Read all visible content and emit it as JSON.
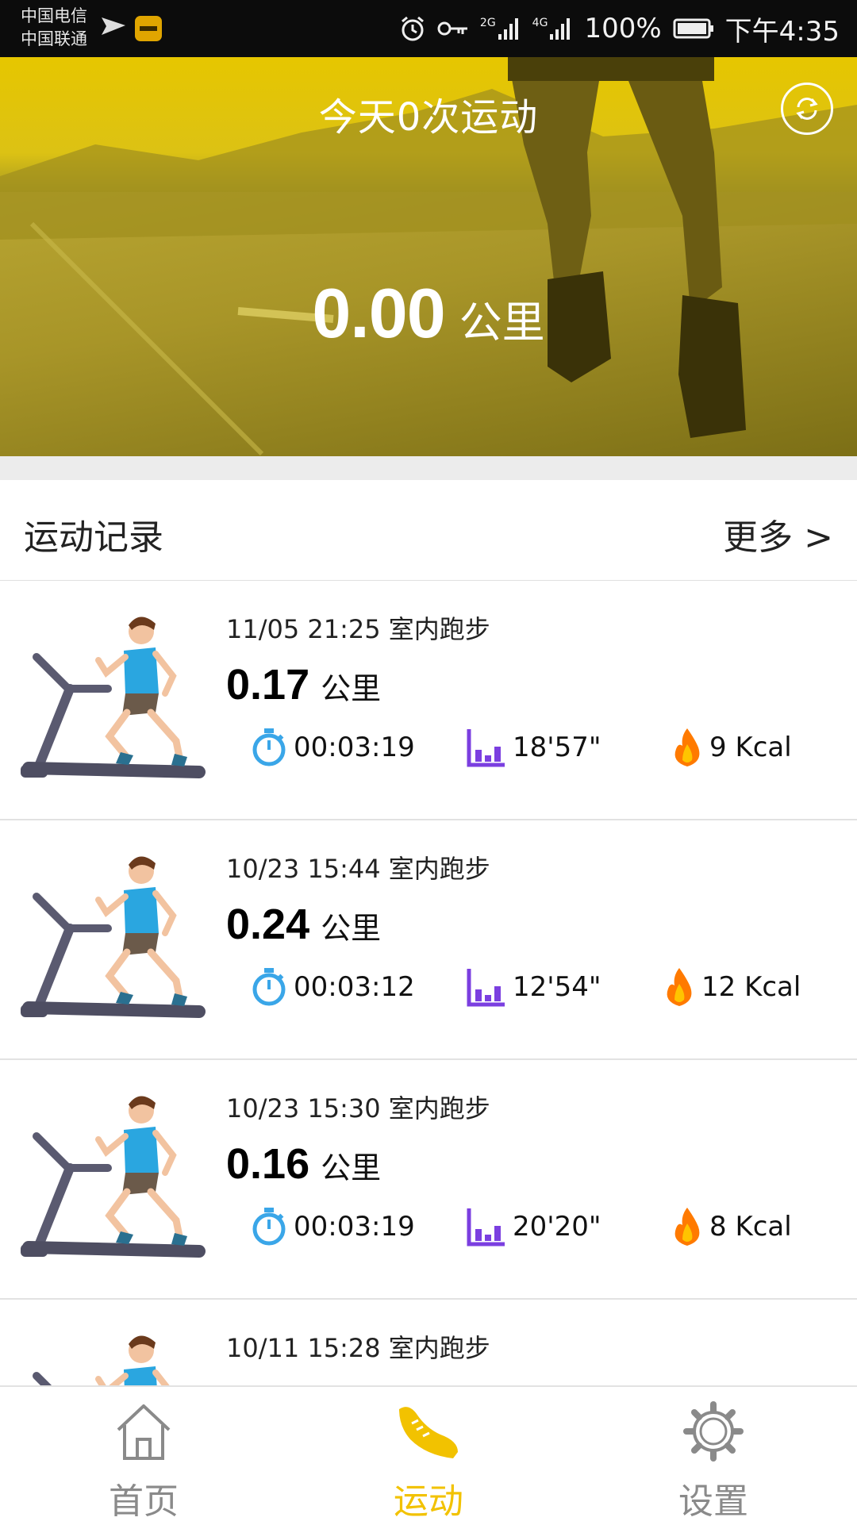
{
  "status_bar": {
    "carrier_1": "中国电信",
    "carrier_2": "中国联通",
    "network_2g": "2G",
    "network_4g": "4G",
    "battery": "100%",
    "time": "下午4:35"
  },
  "hero": {
    "title": "今天0次运动",
    "distance": "0.00",
    "distance_unit": "公里",
    "refresh_icon": "refresh-icon"
  },
  "records_section": {
    "title": "运动记录",
    "more_label": "更多 >"
  },
  "records": [
    {
      "datetime": "11/05 21:25 室内跑步",
      "distance": "0.17",
      "unit": "公里",
      "duration": "00:03:19",
      "pace": "18'57\"",
      "calories": "9 Kcal"
    },
    {
      "datetime": "10/23 15:44 室内跑步",
      "distance": "0.24",
      "unit": "公里",
      "duration": "00:03:12",
      "pace": "12'54\"",
      "calories": "12 Kcal"
    },
    {
      "datetime": "10/23 15:30 室内跑步",
      "distance": "0.16",
      "unit": "公里",
      "duration": "00:03:19",
      "pace": "20'20\"",
      "calories": "8 Kcal"
    },
    {
      "datetime": "10/11 15:28 室内跑步"
    }
  ],
  "bottom_nav": {
    "items": [
      {
        "label": "首页",
        "icon": "home-icon"
      },
      {
        "label": "运动",
        "icon": "shoe-icon",
        "active": true
      },
      {
        "label": "设置",
        "icon": "gear-icon"
      }
    ]
  },
  "colors": {
    "accent": "#f2c200",
    "stopwatch": "#3aa6e8",
    "pace": "#7b3fe0",
    "flame": "#ff8a00"
  }
}
